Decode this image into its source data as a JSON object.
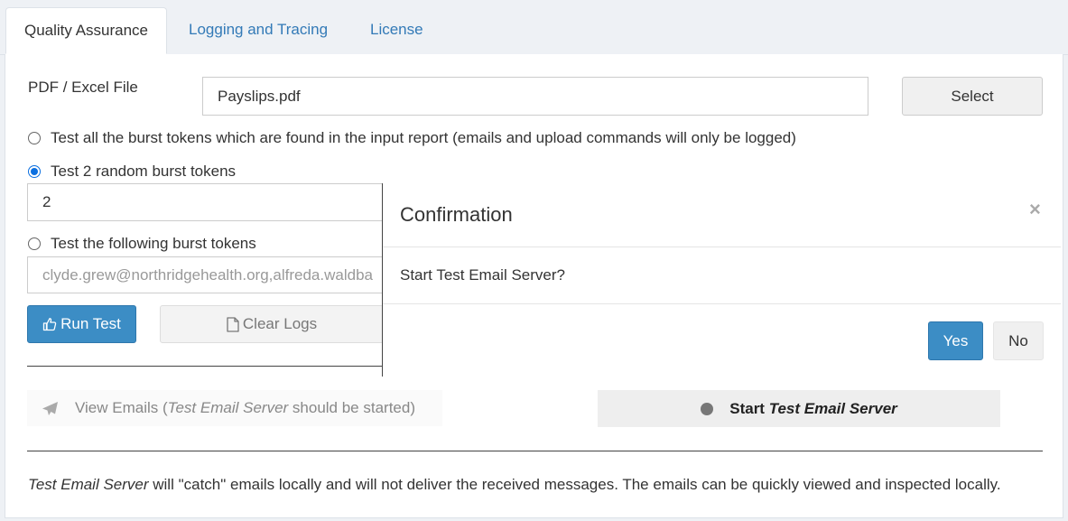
{
  "tabs": [
    {
      "label": "Quality Assurance",
      "active": true
    },
    {
      "label": "Logging and Tracing",
      "active": false
    },
    {
      "label": "License",
      "active": false
    }
  ],
  "file": {
    "label": "PDF / Excel File",
    "value": "Payslips.pdf",
    "select_label": "Select"
  },
  "options": {
    "all": "Test all the burst tokens which are found in the input report (emails and upload commands will only be logged)",
    "random": "Test 2 random burst tokens",
    "random_count": "2",
    "following": "Test the following burst tokens",
    "tokens_value": "clyde.grew@northridgehealth.org,alfreda.waldba",
    "selected": "random"
  },
  "actions": {
    "run_test": "Run Test",
    "clear_logs": "Clear Logs"
  },
  "email": {
    "view_prefix": "View Emails (",
    "view_em": "Test Email Server",
    "view_suffix": " should be started)",
    "start_prefix": "Start ",
    "start_em": "Test Email Server"
  },
  "footer": {
    "em": "Test Email Server",
    "text": " will \"catch\" emails locally and will not deliver the received messages. The emails can be quickly viewed and inspected locally."
  },
  "modal": {
    "title": "Confirmation",
    "close": "×",
    "message": "Start Test Email Server?",
    "yes": "Yes",
    "no": "No"
  },
  "colors": {
    "accent": "#3c8dc5",
    "link": "#337ab7",
    "status_dot": "#777777"
  }
}
